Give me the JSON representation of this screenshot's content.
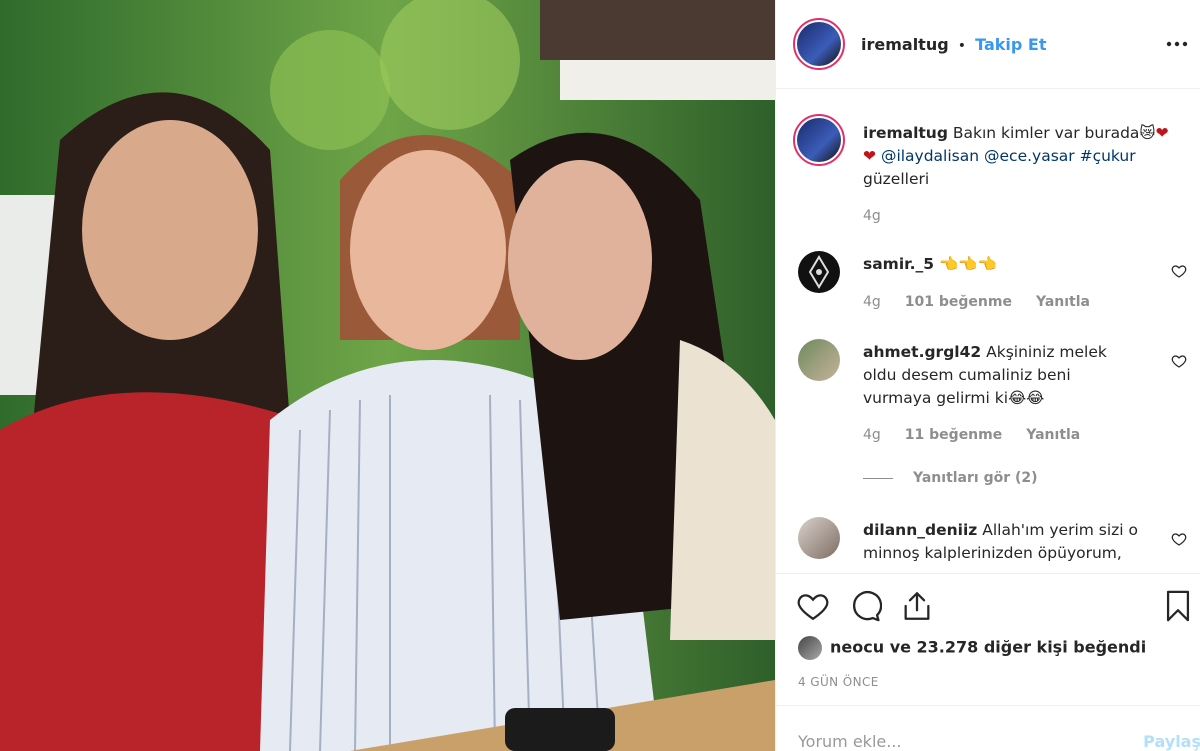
{
  "post": {
    "author": "iremaltug",
    "follow_label": "Takip Et",
    "separator": "•",
    "more_icon": "more-horizontal-icon"
  },
  "caption": {
    "username": "iremaltug",
    "text_1": "Bakın kimler var burada",
    "mention_1": "@ilaydalisan",
    "mention_2": "@ece.yasar",
    "hashtag": "#çukur",
    "text_2": "güzelleri",
    "time": "4g"
  },
  "comments": [
    {
      "username": "samir._5",
      "text": "👈👈👈",
      "time": "4g",
      "likes": "101 beğenme",
      "reply": "Yanıtla"
    },
    {
      "username": "ahmet.grgl42",
      "text_lines": [
        "Akşininiz melek",
        "oldu desem cumaliniz beni",
        "vurmaya gelirmi ki😂😂"
      ],
      "time": "4g",
      "likes": "11 beğenme",
      "reply": "Yanıtla",
      "view_replies": "Yanıtları gör (2)"
    },
    {
      "username": "dilann_deniiz",
      "text_lines": [
        "Allah'ım yerim sizi o",
        "minnoş kalplerinizden öpüyorum,"
      ]
    }
  ],
  "actions": {
    "like_icon": "heart-icon",
    "comment_icon": "comment-icon",
    "share_icon": "share-icon",
    "save_icon": "bookmark-icon"
  },
  "likes": {
    "liker": "neocu",
    "text": "ve 23.278 diğer kişi beğendi"
  },
  "date": "4 GÜN ÖNCE",
  "add_comment": {
    "placeholder": "Yorum ekle...",
    "post_label": "Paylaş"
  },
  "colors": {
    "link": "#3897f0",
    "tag": "#00376b",
    "muted": "#8e8e8e",
    "story_ring": "#e1306c"
  }
}
